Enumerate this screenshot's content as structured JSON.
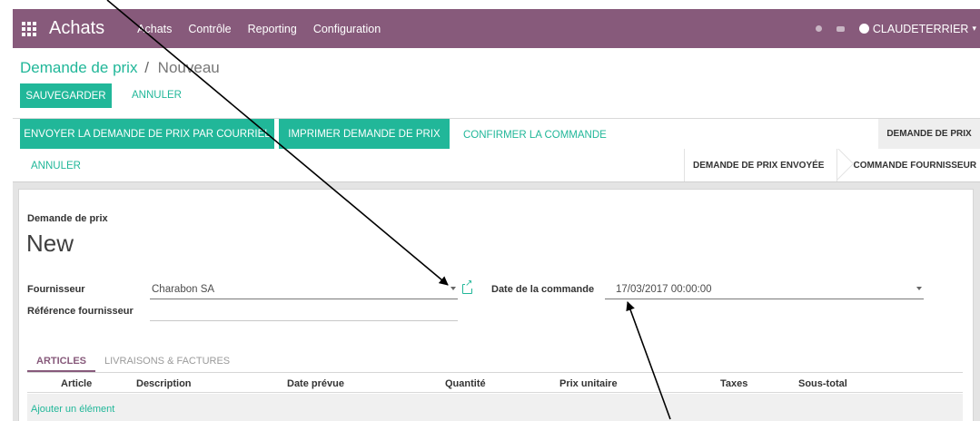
{
  "navbar": {
    "app_name": "Achats",
    "menu": [
      "Achats",
      "Contrôle",
      "Reporting",
      "Configuration"
    ],
    "user": "CLAUDETERRIER",
    "color": "#875a7b"
  },
  "breadcrumb": {
    "parent": "Demande de prix",
    "separator": "/",
    "current": "Nouveau"
  },
  "control": {
    "save_label": "SAUVEGARDER",
    "discard_label": "ANNULER"
  },
  "statusbar": {
    "send_label": "ENVOYER LA DEMANDE DE PRIX PAR COURRIEL",
    "print_label": "IMPRIMER DEMANDE DE PRIX",
    "confirm_label": "CONFIRMER LA COMMANDE",
    "cancel_label": "ANNULER",
    "stages": [
      "DEMANDE DE PRIX",
      "DEMANDE DE PRIX ENVOYÉE",
      "COMMANDE FOURNISSEUR"
    ],
    "active_stage": "DEMANDE DE PRIX"
  },
  "form": {
    "doc_label": "Demande de prix",
    "doc_name": "New",
    "vendor_label": "Fournisseur",
    "vendor_value": "Charabon SA",
    "vendor_ref_label": "Référence fournisseur",
    "vendor_ref_value": "",
    "order_date_label": "Date de la commande",
    "order_date_value": "17/03/2017 00:00:00"
  },
  "tabs": [
    "ARTICLES",
    "LIVRAISONS & FACTURES"
  ],
  "active_tab": "ARTICLES",
  "table": {
    "columns": [
      "Article",
      "Description",
      "Date prévue",
      "Quantité",
      "Prix unitaire",
      "Taxes",
      "Sous-total"
    ],
    "add_line_label": "Ajouter un élément"
  },
  "colors": {
    "primary": "#21b799",
    "brand": "#875a7b",
    "sheet_bg": "#e4e4e4"
  }
}
